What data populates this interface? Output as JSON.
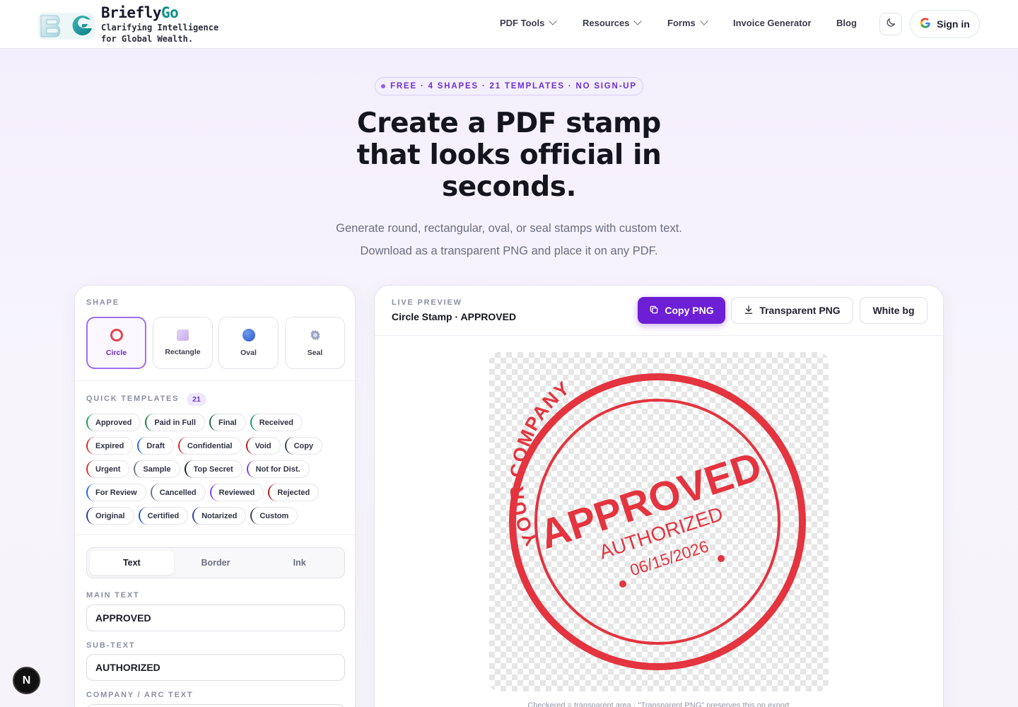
{
  "brand": {
    "logo_letters": "BG",
    "name_prefix": "Briefly",
    "name_suffix": "Go",
    "tagline": "Clarifying Intelligence for Global Wealth."
  },
  "nav": {
    "items": [
      {
        "label": "PDF Tools",
        "dropdown": true
      },
      {
        "label": "Resources",
        "dropdown": true
      },
      {
        "label": "Forms",
        "dropdown": true
      },
      {
        "label": "Invoice Generator",
        "dropdown": false
      },
      {
        "label": "Blog",
        "dropdown": false
      }
    ],
    "signin_label": "Sign in",
    "theme_icon": "moon-icon"
  },
  "hero": {
    "pill": "FREE · 4 SHAPES · 21 TEMPLATES · NO SIGN-UP",
    "title": "Create a PDF stamp that looks official in seconds.",
    "subtitle": "Generate round, rectangular, oval, or seal stamps with custom text. Download as a transparent PNG and place it on any PDF."
  },
  "editor": {
    "shape_label": "SHAPE",
    "shapes": [
      {
        "label": "Circle",
        "icon": "circle-icon",
        "active": true
      },
      {
        "label": "Rectangle",
        "icon": "rectangle-icon",
        "active": false
      },
      {
        "label": "Oval",
        "icon": "oval-icon",
        "active": false
      },
      {
        "label": "Seal",
        "icon": "seal-icon",
        "active": false
      }
    ],
    "templates_label": "QUICK TEMPLATES",
    "templates_count": "21",
    "template_rows": [
      [
        {
          "label": "Approved",
          "color": "#16a34a"
        },
        {
          "label": "Paid in Full",
          "color": "#15803d"
        },
        {
          "label": "Final",
          "color": "#166534"
        },
        {
          "label": "Received",
          "color": "#0e9488"
        }
      ],
      [
        {
          "label": "Expired",
          "color": "#dc2626"
        },
        {
          "label": "Draft",
          "color": "#2563eb"
        },
        {
          "label": "Confidential",
          "color": "#dc2626"
        },
        {
          "label": "Void",
          "color": "#b91c1c"
        },
        {
          "label": "Copy",
          "color": "#334155"
        }
      ],
      [
        {
          "label": "Urgent",
          "color": "#dc2626"
        },
        {
          "label": "Sample",
          "color": "#6b7280"
        },
        {
          "label": "Top Secret",
          "color": "#111827"
        },
        {
          "label": "Not for Dist.",
          "color": "#7c3aed"
        }
      ],
      [
        {
          "label": "For Review",
          "color": "#2563eb"
        },
        {
          "label": "Cancelled",
          "color": "#6b7280"
        },
        {
          "label": "Reviewed",
          "color": "#7c3aed"
        },
        {
          "label": "Rejected",
          "color": "#b91c1c"
        }
      ],
      [
        {
          "label": "Original",
          "color": "#1e3a8a"
        },
        {
          "label": "Certified",
          "color": "#1d4ed8"
        },
        {
          "label": "Notarized",
          "color": "#1e40af"
        },
        {
          "label": "Custom",
          "color": "#334155"
        }
      ]
    ],
    "tabs": [
      {
        "label": "Text",
        "active": true
      },
      {
        "label": "Border",
        "active": false
      },
      {
        "label": "Ink",
        "active": false
      }
    ],
    "main_text_label": "MAIN TEXT",
    "main_text_value": "APPROVED",
    "sub_text_label": "SUB-TEXT",
    "sub_text_value": "AUTHORIZED",
    "company_label": "COMPANY / ARC TEXT"
  },
  "preview": {
    "label": "LIVE PREVIEW",
    "title": "Circle Stamp · APPROVED",
    "copy_png": "Copy PNG",
    "transparent_png": "Transparent PNG",
    "white_bg": "White bg",
    "stamp": {
      "arc_text": "YOUR COMPANY",
      "main": "APPROVED",
      "sub": "AUTHORIZED",
      "date": "06/15/2026",
      "ink_color": "#e3343f"
    },
    "note": "Checkered = transparent area · \"Transparent PNG\" preserves this on export."
  },
  "floating_badge": "N"
}
